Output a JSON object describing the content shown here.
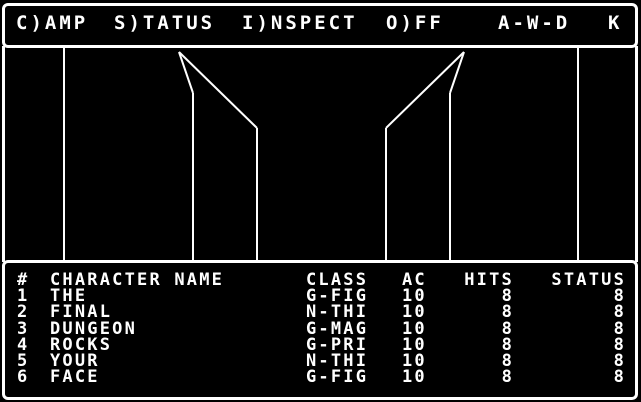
{
  "menu": {
    "camp": "C)AMP",
    "status": "S)TATUS",
    "inspect": "I)NSPECT",
    "off": "O)FF",
    "awd": "A-W-D",
    "k": "K"
  },
  "party": {
    "headers": {
      "num": "#",
      "name": "CHARACTER NAME",
      "class": "CLASS",
      "ac": "AC",
      "hits": "HITS",
      "status": "STATUS"
    },
    "rows": [
      {
        "num": "1",
        "name": "THE",
        "class": "G-FIG",
        "ac": "10",
        "hits": "8",
        "status": "8"
      },
      {
        "num": "2",
        "name": "FINAL",
        "class": "N-THI",
        "ac": "10",
        "hits": "8",
        "status": "8"
      },
      {
        "num": "3",
        "name": "DUNGEON",
        "class": "G-MAG",
        "ac": "10",
        "hits": "8",
        "status": "8"
      },
      {
        "num": "4",
        "name": "ROCKS",
        "class": "G-PRI",
        "ac": "10",
        "hits": "8",
        "status": "8"
      },
      {
        "num": "5",
        "name": "YOUR",
        "class": "N-THI",
        "ac": "10",
        "hits": "8",
        "status": "8"
      },
      {
        "num": "6",
        "name": "FACE",
        "class": "G-FIG",
        "ac": "10",
        "hits": "8",
        "status": "8"
      }
    ]
  },
  "colors": {
    "foreground": "#ffffff",
    "background": "#000000"
  }
}
